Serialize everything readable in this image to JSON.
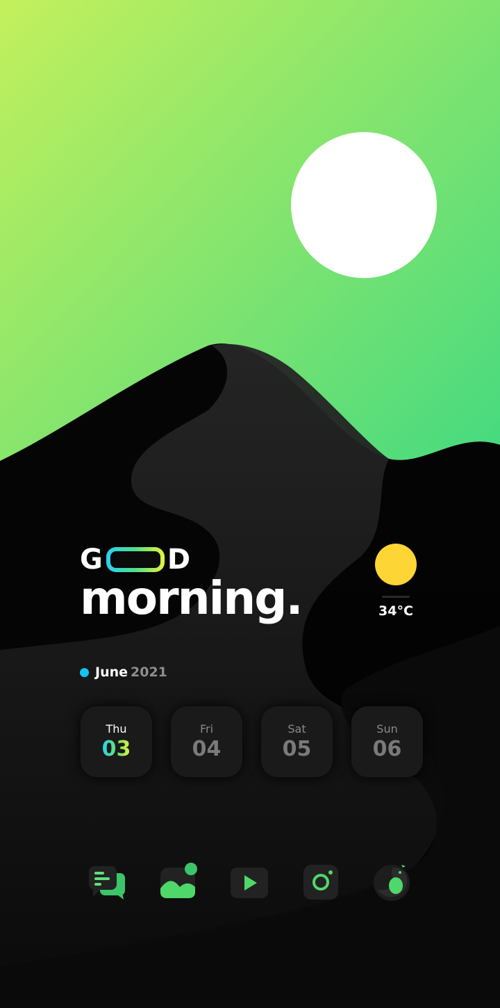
{
  "greeting": {
    "line1_left": "G",
    "line1_right": "D",
    "line2": "morning."
  },
  "weather": {
    "temperature": "34°C",
    "icon": "sun-icon"
  },
  "date": {
    "month": "June",
    "year": "2021"
  },
  "days": [
    {
      "name": "Thu",
      "number": "03",
      "active": true
    },
    {
      "name": "Fri",
      "number": "04",
      "active": false
    },
    {
      "name": "Sat",
      "number": "05",
      "active": false
    },
    {
      "name": "Sun",
      "number": "06",
      "active": false
    }
  ],
  "dock": [
    {
      "icon": "messages-icon"
    },
    {
      "icon": "gallery-icon"
    },
    {
      "icon": "video-player-icon"
    },
    {
      "icon": "camera-icon"
    },
    {
      "icon": "twitter-bird-icon"
    }
  ],
  "colors": {
    "sky_top": "#c3f05c",
    "sky_bottom": "#3dd882",
    "sun": "#ffffff",
    "weather_sun": "#fdd535",
    "accent_blue": "#12c3f4",
    "accent_green": "#4fe08a",
    "accent_yellow": "#e8f23a"
  }
}
